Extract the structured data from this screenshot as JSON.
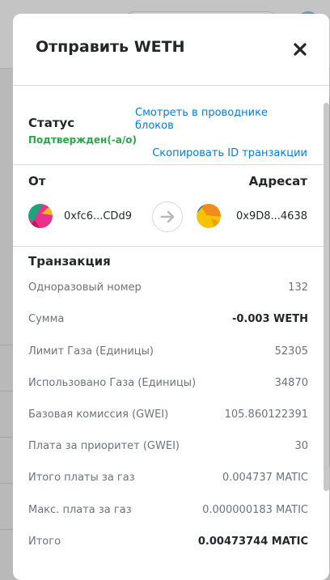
{
  "modal": {
    "title": "Отправить WETH",
    "close_icon": "close-icon"
  },
  "status": {
    "label": "Статус",
    "value": "Подтвержден(-а/о)",
    "explorer_link": "Смотреть в проводнике блоков",
    "copy_link": "Скопировать ID транзакции"
  },
  "parties": {
    "from_label": "От",
    "to_label": "Адресат",
    "from_address": "0xfc6...CDd9",
    "to_address": "0x9D8...4638",
    "arrow_icon": "arrow-right-icon"
  },
  "transaction": {
    "title": "Транзакция",
    "rows": [
      {
        "label": "Одноразовый номер",
        "value": "132",
        "strong": false
      },
      {
        "label": "Сумма",
        "value": "-0.003 WETH",
        "strong": true
      },
      {
        "label": "Лимит Газа (Единицы)",
        "value": "52305",
        "strong": false
      },
      {
        "label": "Использовано Газа (Единицы)",
        "value": "34870",
        "strong": false
      },
      {
        "label": "Базовая комиссия (GWEI)",
        "value": "105.860122391",
        "strong": false
      },
      {
        "label": "Плата за приоритет (GWEI)",
        "value": "30",
        "strong": false
      },
      {
        "label": "Итого платы за газ",
        "value": "0.004737 MATIC",
        "strong": false
      },
      {
        "label": "Макс. плата за газ",
        "value": "0.000000183 MATIC",
        "strong": false
      },
      {
        "label": "Итого",
        "value": "0.00473744 MATIC",
        "strong": true
      }
    ]
  },
  "colors": {
    "link": "#037dd6",
    "success": "#28a745"
  }
}
